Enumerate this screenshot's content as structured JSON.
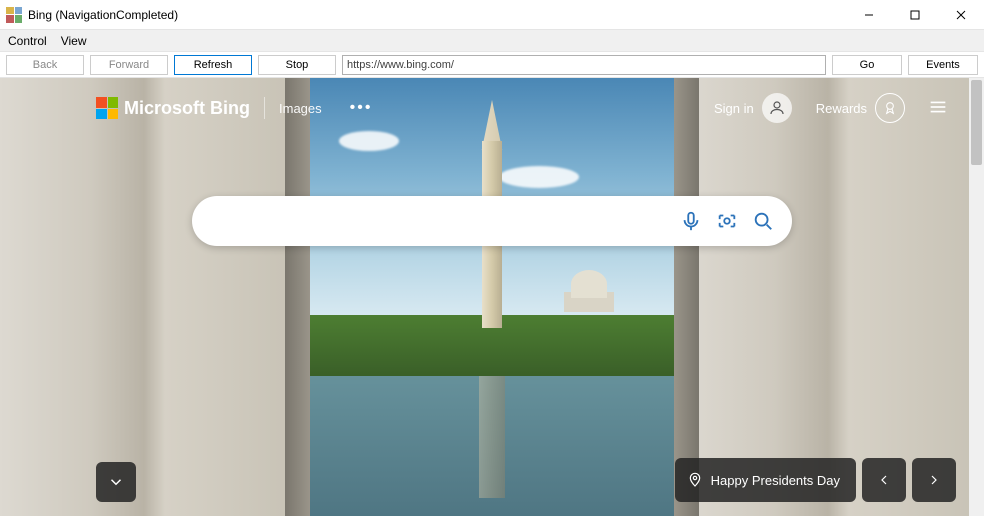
{
  "window": {
    "title": "Bing (NavigationCompleted)"
  },
  "menu": {
    "items": [
      "Control",
      "View"
    ]
  },
  "toolbar": {
    "back": "Back",
    "forward": "Forward",
    "refresh": "Refresh",
    "stop": "Stop",
    "url": "https://www.bing.com/",
    "go": "Go",
    "events": "Events"
  },
  "bing": {
    "brand": "Microsoft Bing",
    "nav": {
      "images": "Images"
    },
    "signin": "Sign in",
    "rewards": "Rewards",
    "search_placeholder": "",
    "headline": "Happy Presidents Day"
  }
}
